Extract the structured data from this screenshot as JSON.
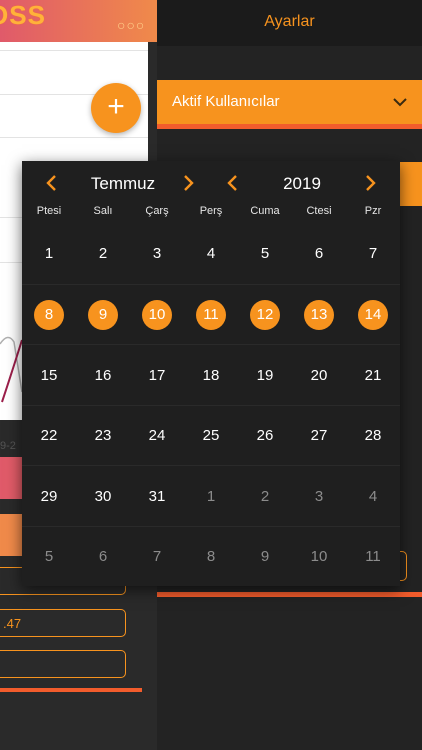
{
  "left_app": {
    "logo_text": "OSS",
    "card_date": "9-2",
    "fab_label": "+",
    "field_value": ".47"
  },
  "settings": {
    "title": "Ayarlar",
    "dropdown_label": "Aktif Kullanıcılar"
  },
  "calendar": {
    "month": "Temmuz",
    "year": "2019",
    "weekdays": [
      "Ptesi",
      "Salı",
      "Çarş",
      "Perş",
      "Cuma",
      "Ctesi",
      "Pzr"
    ],
    "weeks": [
      [
        {
          "d": "1"
        },
        {
          "d": "2"
        },
        {
          "d": "3"
        },
        {
          "d": "4"
        },
        {
          "d": "5"
        },
        {
          "d": "6"
        },
        {
          "d": "7"
        }
      ],
      [
        {
          "d": "8",
          "sel": true
        },
        {
          "d": "9",
          "sel": true
        },
        {
          "d": "10",
          "sel": true
        },
        {
          "d": "11",
          "sel": true
        },
        {
          "d": "12",
          "sel": true
        },
        {
          "d": "13",
          "sel": true
        },
        {
          "d": "14",
          "sel": true
        }
      ],
      [
        {
          "d": "15"
        },
        {
          "d": "16"
        },
        {
          "d": "17"
        },
        {
          "d": "18"
        },
        {
          "d": "19"
        },
        {
          "d": "20"
        },
        {
          "d": "21"
        }
      ],
      [
        {
          "d": "22"
        },
        {
          "d": "23"
        },
        {
          "d": "24"
        },
        {
          "d": "25"
        },
        {
          "d": "26"
        },
        {
          "d": "27"
        },
        {
          "d": "28"
        }
      ],
      [
        {
          "d": "29"
        },
        {
          "d": "30"
        },
        {
          "d": "31"
        },
        {
          "d": "1",
          "other": true
        },
        {
          "d": "2",
          "other": true
        },
        {
          "d": "3",
          "other": true
        },
        {
          "d": "4",
          "other": true
        }
      ],
      [
        {
          "d": "5",
          "other": true
        },
        {
          "d": "6",
          "other": true
        },
        {
          "d": "7",
          "other": true
        },
        {
          "d": "8",
          "other": true
        },
        {
          "d": "9",
          "other": true
        },
        {
          "d": "10",
          "other": true
        },
        {
          "d": "11",
          "other": true
        }
      ]
    ]
  },
  "colors": {
    "accent": "#f7931e",
    "underline": "#f25c2c",
    "background": "#232323",
    "popup": "#1f1f1f"
  },
  "icons": {
    "prev": "chevron-left-icon",
    "next": "chevron-right-icon",
    "dropdown": "chevron-down-icon",
    "menu": "more-dots-icon",
    "add": "plus-icon"
  }
}
